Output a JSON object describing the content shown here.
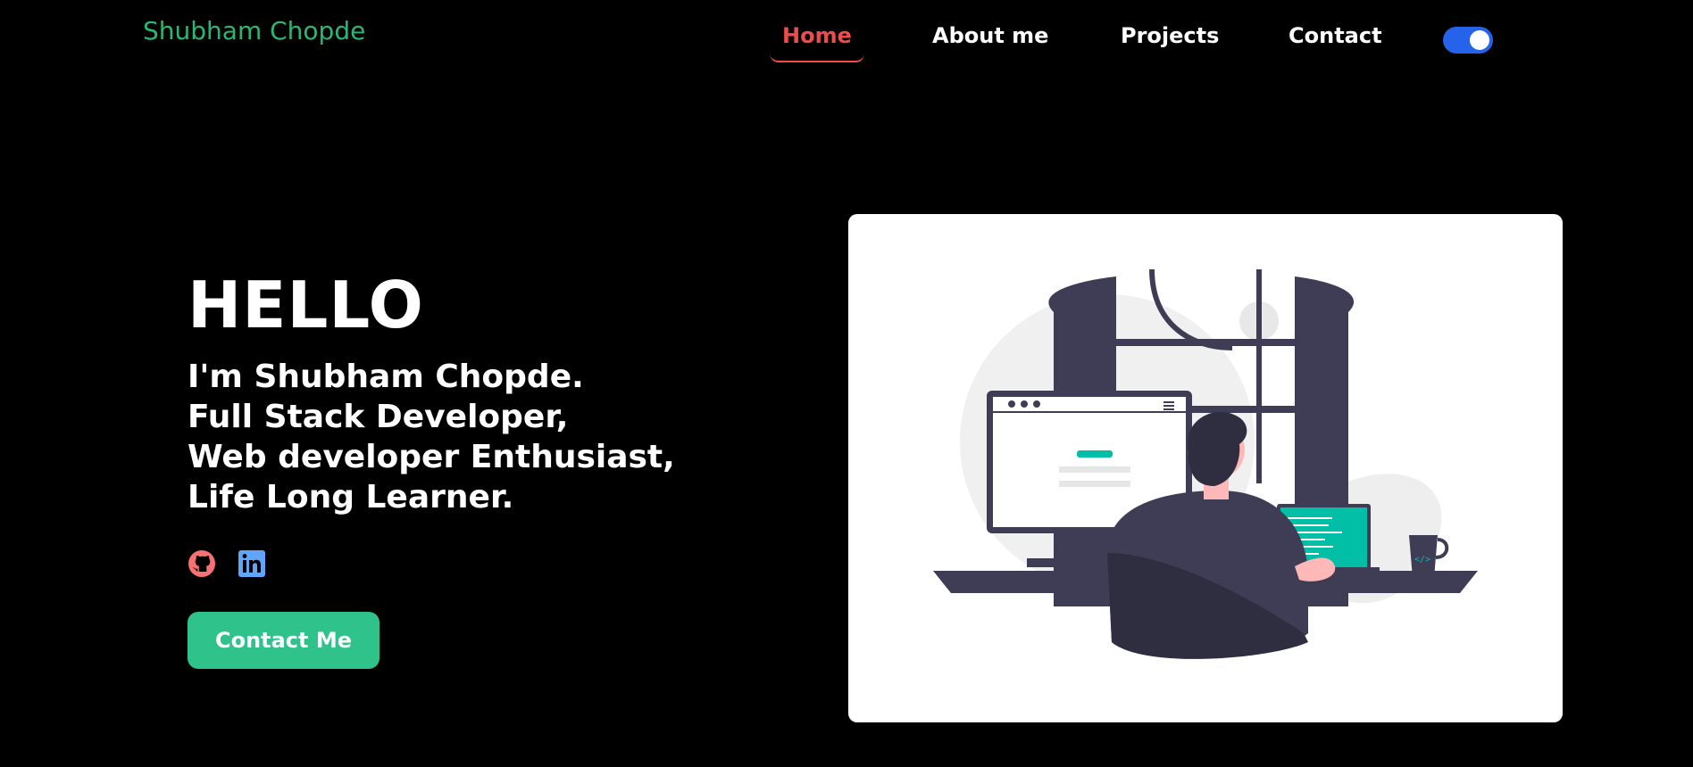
{
  "header": {
    "brand": "Shubham Chopde",
    "nav": [
      {
        "label": "Home",
        "active": true
      },
      {
        "label": "About me",
        "active": false
      },
      {
        "label": "Projects",
        "active": false
      },
      {
        "label": "Contact",
        "active": false
      }
    ],
    "theme_toggle": {
      "state": "on",
      "color": "#2563eb"
    }
  },
  "hero": {
    "greeting": "HELLO",
    "lines": [
      "I'm Shubham Chopde.",
      "Full Stack Developer,",
      "Web developer Enthusiast,",
      "Life Long Learner."
    ],
    "socials": [
      {
        "icon": "github-icon",
        "color": "#f87171"
      },
      {
        "icon": "linkedin-icon",
        "color": "#60a5fa"
      }
    ],
    "cta_label": "Contact Me"
  },
  "colors": {
    "brand": "#2bb673",
    "active_nav": "#ef4b4b",
    "cta": "#2fc28a",
    "background": "#000000"
  }
}
